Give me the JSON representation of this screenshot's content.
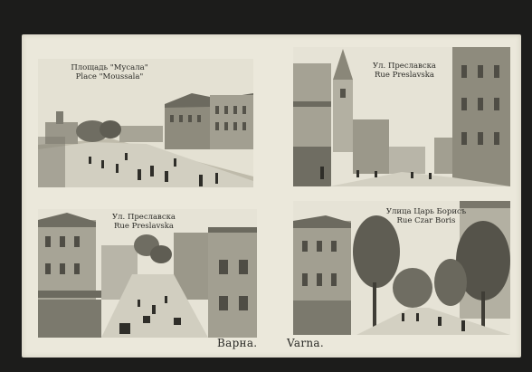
{
  "postcard": {
    "panels": [
      {
        "caption_bg": "Площадь \"Мусала\"",
        "caption_fr": "Place \"Moussala\""
      },
      {
        "caption_bg": "Ул. Преславска",
        "caption_fr": "Rue Preslavska"
      },
      {
        "caption_bg": "Ул. Преславска",
        "caption_fr": "Rue Preslavska"
      },
      {
        "caption_bg": "Улица Царь Борисъ",
        "caption_fr": "Rue Czar Boris"
      }
    ],
    "footer_bg": "Варна.",
    "footer_fr": "Varna."
  },
  "colors": {
    "border": "#1c1c1b",
    "card": "#ebe8db",
    "photo_sky": "#e6e3d6",
    "photo_mid": "#9d9a8c",
    "photo_dark": "#4a4840"
  }
}
